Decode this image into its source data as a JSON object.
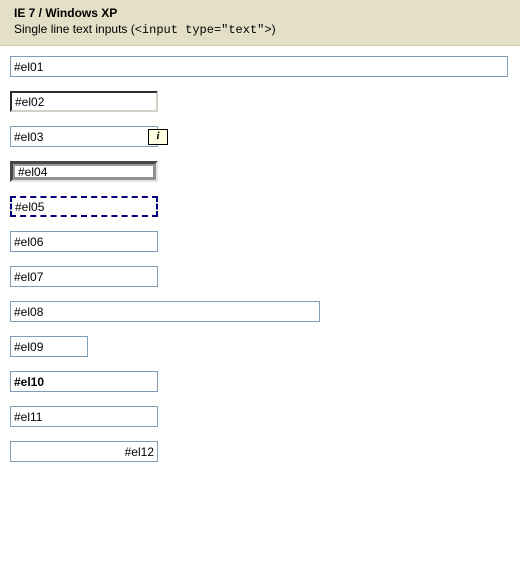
{
  "header": {
    "title": "IE 7 / Windows XP",
    "subtitle_prefix": "Single line text inputs (",
    "subtitle_code": "<input type=\"text\">",
    "subtitle_suffix": ")"
  },
  "inputs": {
    "el01": "#el01",
    "el02": "#el02",
    "el03": "#el03",
    "el04": "#el04",
    "el05": "#el05",
    "el06": "#el06",
    "el07": "#el07",
    "el08": "#el08",
    "el09": "#el09",
    "el10": "#el10",
    "el11": "#el11",
    "el12": "#el12"
  },
  "tooltip_glyph": "i"
}
